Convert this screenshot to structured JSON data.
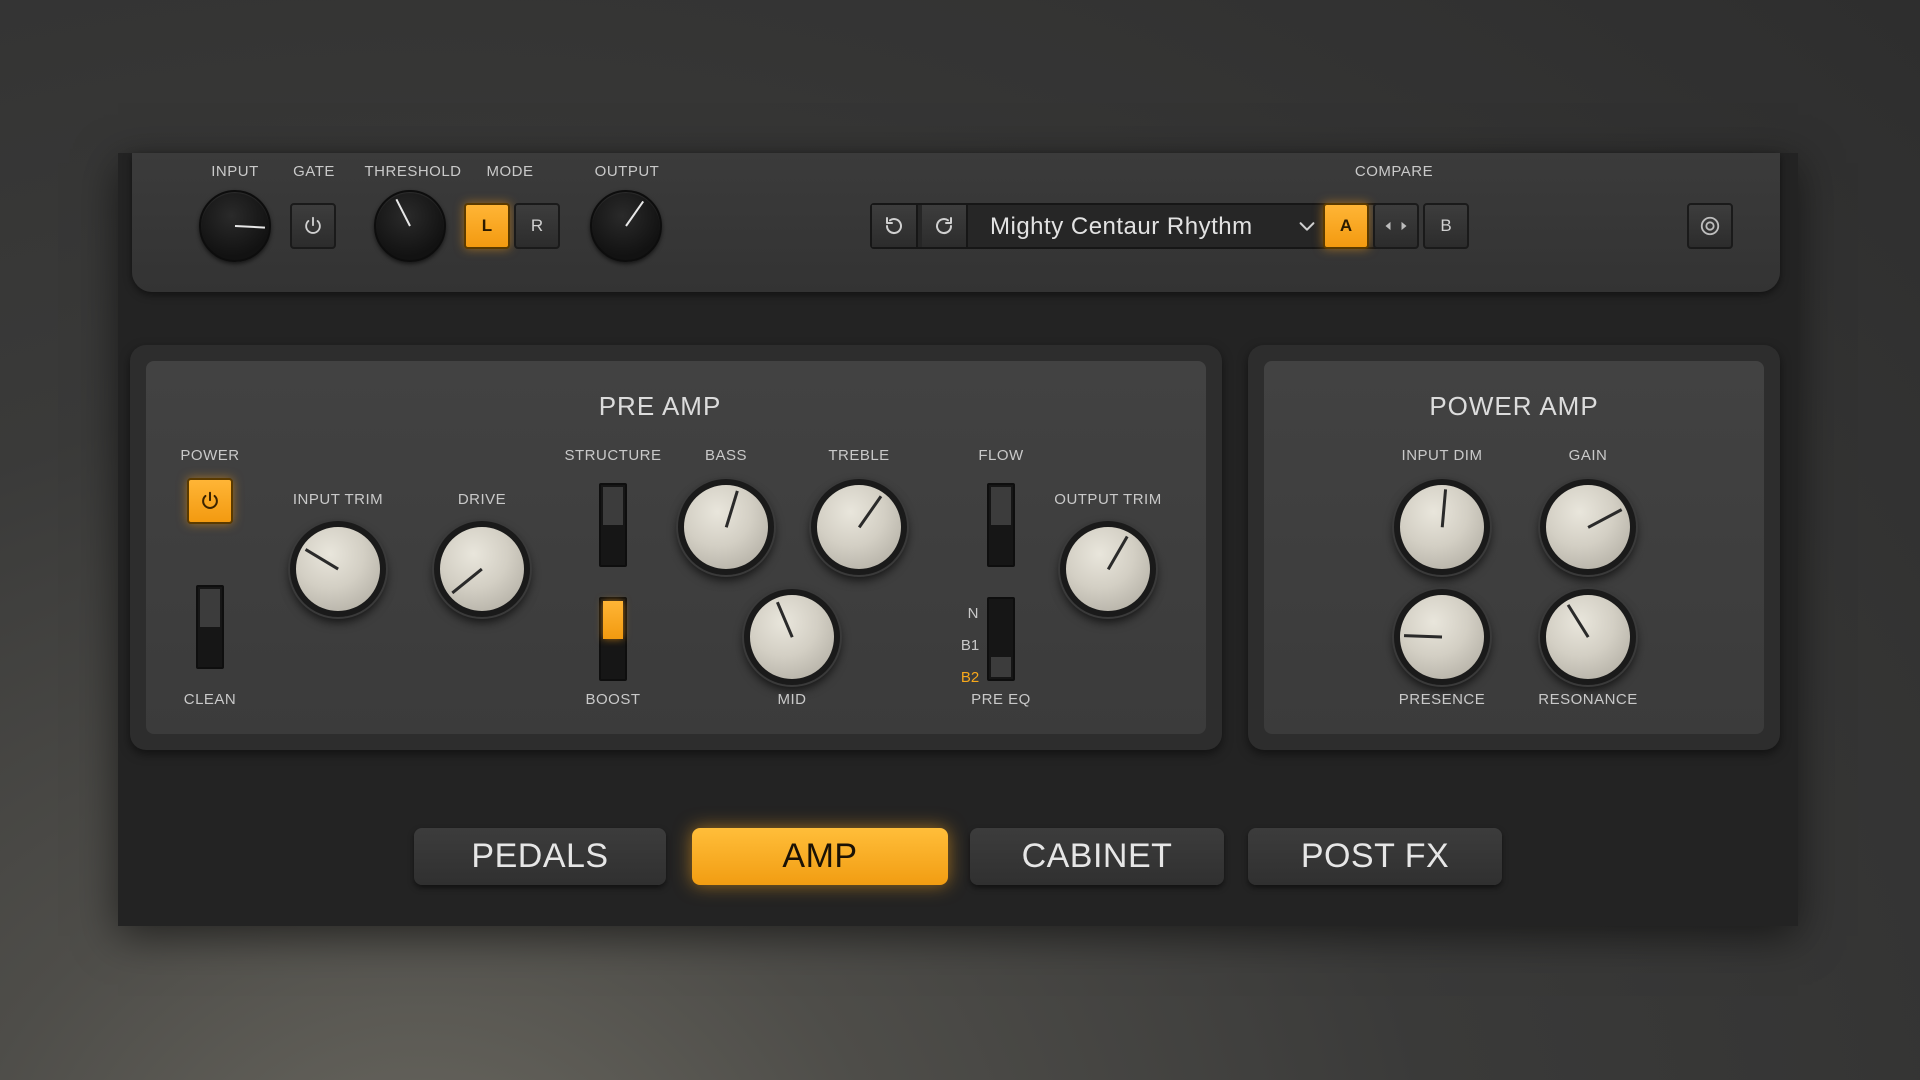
{
  "topbar": {
    "input_label": "INPUT",
    "gate_label": "GATE",
    "threshold_label": "THRESHOLD",
    "mode_label": "MODE",
    "mode_left": "L",
    "mode_right": "R",
    "mode_selected": "L",
    "output_label": "OUTPUT",
    "preset_name": "Mighty Centaur Rhythm",
    "compare_label": "COMPARE",
    "compare_a": "A",
    "compare_b": "B",
    "compare_selected": "A",
    "icons": {
      "gate": "power-icon",
      "undo": "undo-icon",
      "redo": "redo-icon",
      "dropdown": "chevron-down-icon",
      "prev": "arrow-left-icon",
      "next": "arrow-right-icon",
      "settings": "settings-icon"
    }
  },
  "preamp": {
    "title": "PRE AMP",
    "power_label": "POWER",
    "power_on": true,
    "clean_label": "CLEAN",
    "input_trim_label": "INPUT TRIM",
    "drive_label": "DRIVE",
    "structure_label": "STRUCTURE",
    "boost_label": "BOOST",
    "boost_on": true,
    "bass_label": "BASS",
    "treble_label": "TREBLE",
    "mid_label": "MID",
    "flow_label": "FLOW",
    "pre_eq_label": "PRE EQ",
    "pre_eq_options": [
      "N",
      "B1",
      "B2"
    ],
    "pre_eq_selected": "B2",
    "output_trim_label": "OUTPUT TRIM"
  },
  "poweramp": {
    "title": "POWER AMP",
    "input_dim_label": "INPUT DIM",
    "gain_label": "GAIN",
    "presence_label": "PRESENCE",
    "resonance_label": "RESONANCE"
  },
  "tabs": [
    {
      "label": "PEDALS",
      "active": false
    },
    {
      "label": "AMP",
      "active": true
    },
    {
      "label": "CABINET",
      "active": false
    },
    {
      "label": "POST FX",
      "active": false
    }
  ],
  "colors": {
    "accent": "#f7a81b",
    "panel": "#3e3e3e",
    "background": "#232323",
    "knob_cream": "#d3cfc4"
  }
}
